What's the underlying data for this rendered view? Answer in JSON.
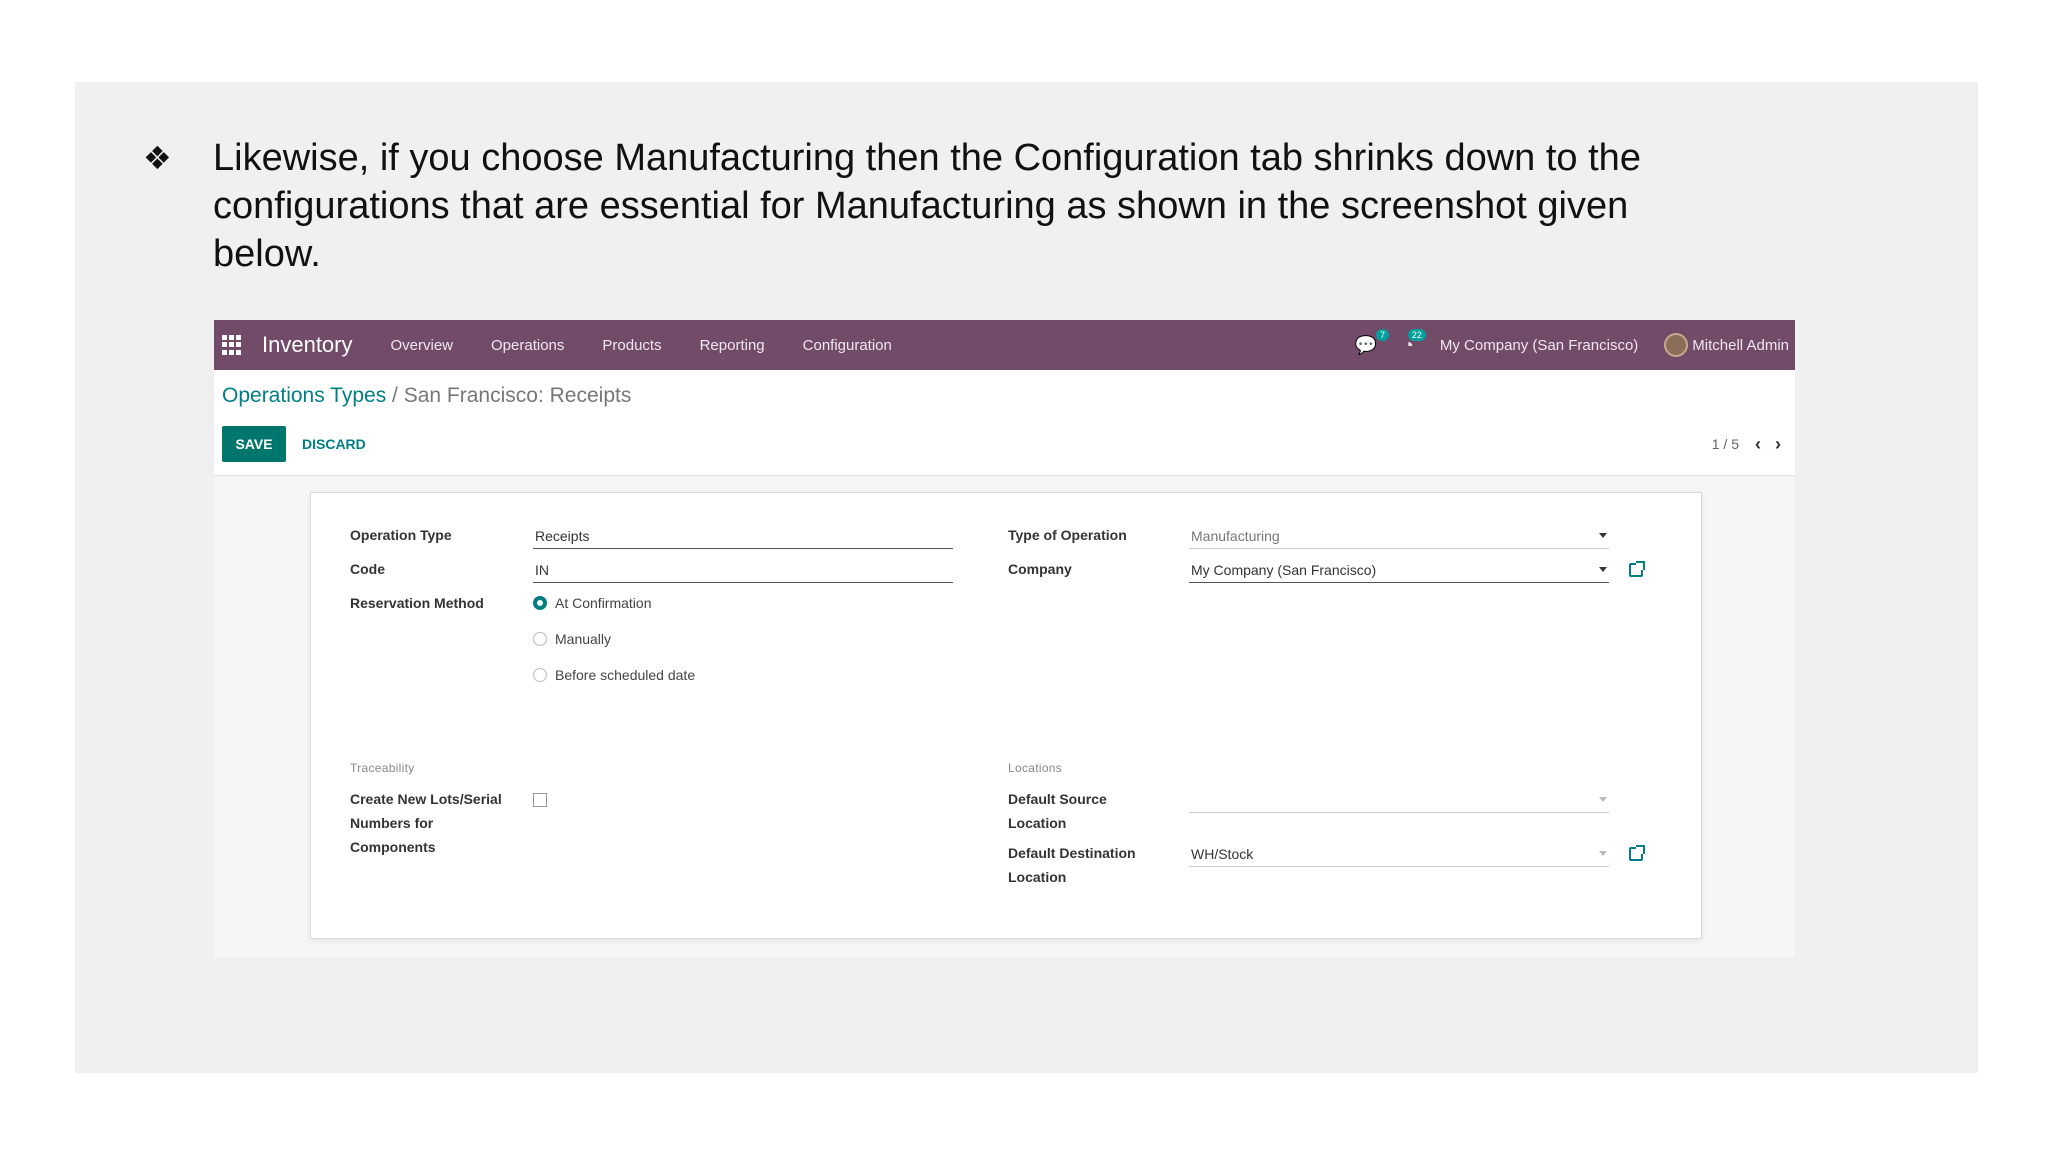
{
  "slide": {
    "bullet_symbol": "❖",
    "bullet_text": "Likewise, if you choose Manufacturing then the Configuration tab shrinks down to the configurations that are essential for Manufacturing as shown in the screenshot given below."
  },
  "navbar": {
    "app_name": "Inventory",
    "menu": [
      "Overview",
      "Operations",
      "Products",
      "Reporting",
      "Configuration"
    ],
    "messages_count": "7",
    "activities_count": "22",
    "company": "My Company (San Francisco)",
    "user": "Mitchell Admin",
    "color": "#714b67"
  },
  "control_panel": {
    "breadcrumb_parent": "Operations Types",
    "breadcrumb_separator": " / ",
    "breadcrumb_current": "San Francisco: Receipts",
    "save_label": "SAVE",
    "discard_label": "DISCARD",
    "pager": "1 / 5",
    "prev_icon": "‹",
    "next_icon": "›",
    "accent": "#017e84"
  },
  "form": {
    "operation_type_label": "Operation Type",
    "operation_type_value": "Receipts",
    "code_label": "Code",
    "code_value": "IN",
    "reservation_method_label": "Reservation Method",
    "reservation_options": [
      "At Confirmation",
      "Manually",
      "Before scheduled date"
    ],
    "reservation_selected": "At Confirmation",
    "type_of_operation_label": "Type of Operation",
    "type_of_operation_value": "Manufacturing",
    "company_label": "Company",
    "company_value": "My Company (San Francisco)",
    "traceability_title": "Traceability",
    "create_lots_label": "Create New Lots/Serial Numbers for Components",
    "create_lots_checked": false,
    "locations_title": "Locations",
    "default_source_label": "Default Source Location",
    "default_source_value": "",
    "default_destination_label": "Default Destination Location",
    "default_destination_value": "WH/Stock"
  }
}
